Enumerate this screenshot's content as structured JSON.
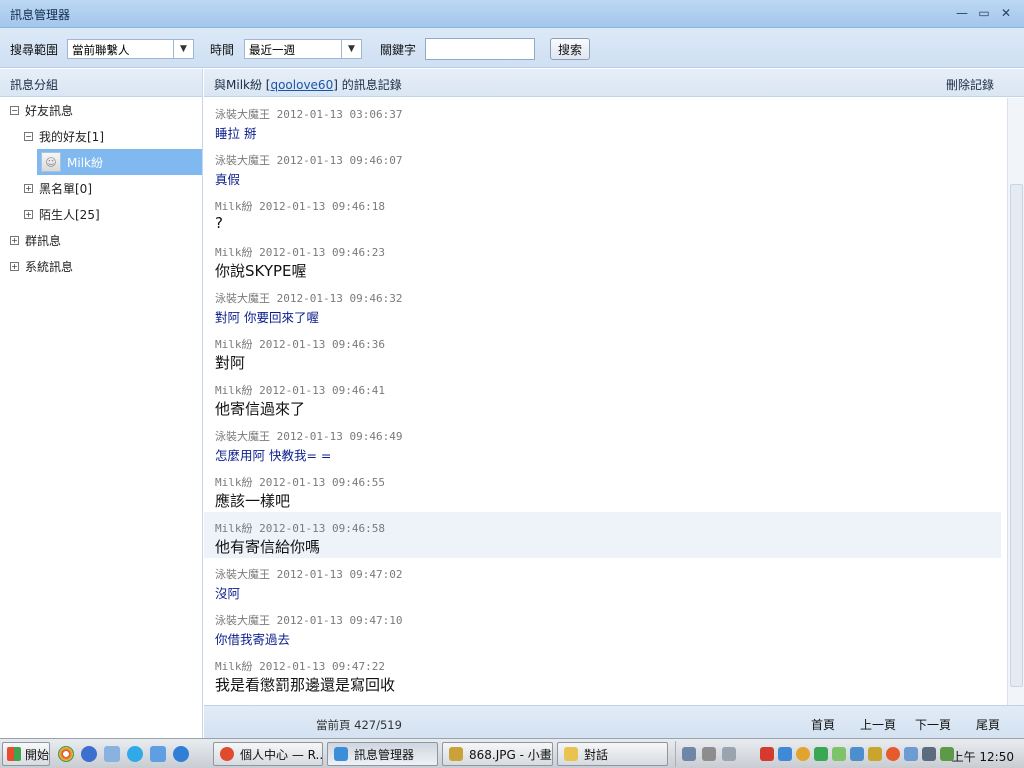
{
  "window": {
    "title": "訊息管理器",
    "controls": {
      "minimize": "—",
      "restore": "▭",
      "close": "✕"
    }
  },
  "toolbar": {
    "scope_label": "搜尋範圍",
    "scope_value": "當前聯繫人",
    "time_label": "時間",
    "time_value": "最近一週",
    "keyword_label": "關鍵字",
    "keyword_value": "",
    "search_label": "搜索",
    "dropdown_arrow": "▼"
  },
  "sidebar": {
    "header": "訊息分組",
    "friends_group": "好友訊息",
    "my_friends": "我的好友[1]",
    "contact": "Milk紛",
    "blacklist": "黑名單[0]",
    "strangers": "陌生人[25]",
    "group_msgs": "群訊息",
    "system_msgs": "系統訊息",
    "expanded_sign": "−",
    "collapsed_sign": "+"
  },
  "conversation": {
    "title_prefix": "與Milk紛 [",
    "title_link": "qoolove60",
    "title_suffix": "] 的訊息記錄",
    "delete_label": "刪除記錄"
  },
  "messages": [
    {
      "meta": "泳裝大魔王 2012-01-13 03:06:37",
      "text": "睡拉 掰",
      "from_me": true
    },
    {
      "meta": "泳裝大魔王 2012-01-13 09:46:07",
      "text": "真假",
      "from_me": true
    },
    {
      "meta": "Milk紛 2012-01-13 09:46:18",
      "text": "?",
      "from_me": false
    },
    {
      "meta": "Milk紛 2012-01-13 09:46:23",
      "text": "你說SKYPE喔",
      "from_me": false
    },
    {
      "meta": "泳裝大魔王 2012-01-13 09:46:32",
      "text": "對阿 你要回來了喔",
      "from_me": true
    },
    {
      "meta": "Milk紛 2012-01-13 09:46:36",
      "text": "對阿",
      "from_me": false
    },
    {
      "meta": "Milk紛 2012-01-13 09:46:41",
      "text": "他寄信過來了",
      "from_me": false
    },
    {
      "meta": "泳裝大魔王 2012-01-13 09:46:49",
      "text": "怎麼用阿 快教我= =",
      "from_me": true
    },
    {
      "meta": "Milk紛 2012-01-13 09:46:55",
      "text": "應該一樣吧",
      "from_me": false
    },
    {
      "meta": "Milk紛 2012-01-13 09:46:58",
      "text": "他有寄信給你嗎",
      "from_me": false,
      "highlighted": true
    },
    {
      "meta": "泳裝大魔王 2012-01-13 09:47:02",
      "text": "沒阿",
      "from_me": true
    },
    {
      "meta": "泳裝大魔王 2012-01-13 09:47:10",
      "text": "你借我寄過去",
      "from_me": true
    },
    {
      "meta": "Milk紛 2012-01-13 09:47:22",
      "text": "我是看懲罰那邊還是寫回收",
      "from_me": false
    }
  ],
  "footer": {
    "page_info": "當前頁 427/519",
    "first": "首頁",
    "prev": "上一頁",
    "next": "下一頁",
    "last": "尾頁"
  },
  "taskbar": {
    "start_label": "開始",
    "tasks": [
      {
        "label": "個人中心 — R...",
        "icon": "chrome-icon",
        "color": "#e04a2f"
      },
      {
        "label": "訊息管理器",
        "icon": "messenger-icon",
        "color": "#3a8fd8",
        "active": true
      },
      {
        "label": "868.JPG - 小畫...",
        "icon": "paint-icon",
        "color": "#c9a23a"
      },
      {
        "label": "對話",
        "icon": "folder-icon",
        "color": "#e8c44e"
      }
    ],
    "clock": "上午 12:50"
  }
}
